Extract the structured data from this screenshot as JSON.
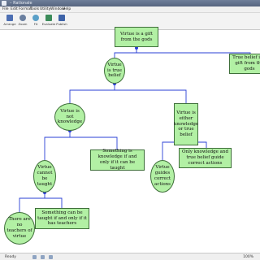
{
  "window": {
    "title": "Virtue.argu - Rationale",
    "title_visible": "– Rationale"
  },
  "menu": [
    "File",
    "Edit",
    "Format",
    "Tools",
    "Utility",
    "Window",
    "Help"
  ],
  "toolbar": [
    {
      "label": "Arrange",
      "icon": "arrange-icon",
      "color": "#4d6fb3"
    },
    {
      "label": "Zoom",
      "icon": "zoom-icon",
      "color": "#6a7f9f"
    },
    {
      "label": "Fit",
      "icon": "fit-icon",
      "color": "#5aa0c8"
    },
    {
      "label": "Evaluate",
      "icon": "evaluate-icon",
      "color": "#3c8c5a"
    },
    {
      "label": "Publish",
      "icon": "publish-icon",
      "color": "#3e63a8"
    }
  ],
  "map": {
    "node_color": "#b2f0a4",
    "edge_color": "#2a3fd4",
    "nodes": {
      "root": "Virtue is a gift from the gods",
      "true_belief_right": "True belief is a gift from the gods",
      "virtue_true_belief": "Virtue is true belief",
      "not_knowledge": "Virtue is not knowledge",
      "either_knowledge": "Virtue is either knowledge or true belief",
      "cannot_be_taught": "Virtue cannot be taught",
      "taught_iff_knowledge": "Something is knowledge if and only if it can be taught",
      "guides_actions": "Virtue guides correct actions",
      "only_knowledge_guide": "Only knowledge and true belief guide correct actions",
      "no_teachers": "There are no teachers of virtue",
      "taught_iff_teachers": "Something can be taught if and only if it has teachers"
    }
  },
  "status": {
    "text": "Ready",
    "zoom": "100%"
  }
}
